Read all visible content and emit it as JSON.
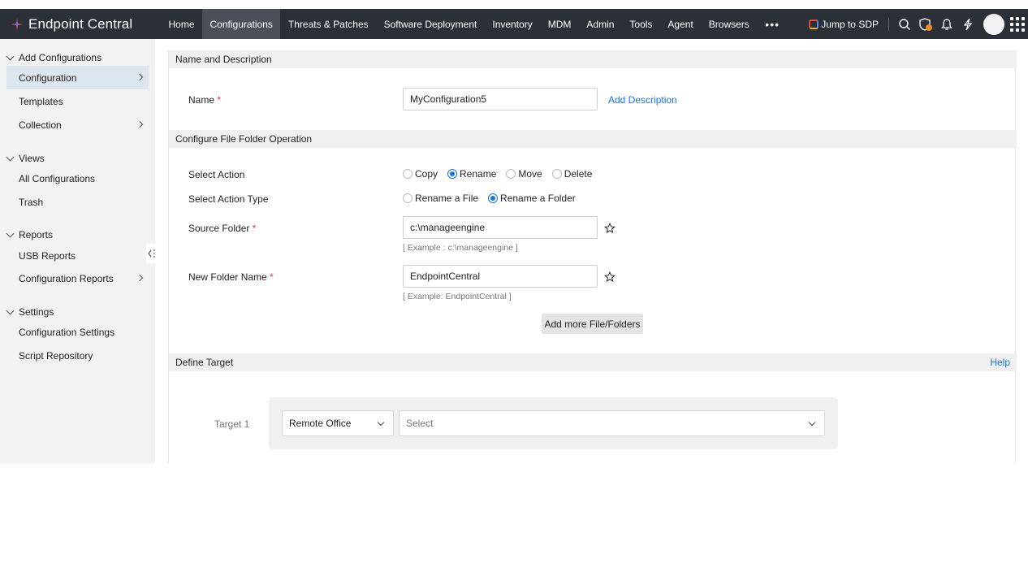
{
  "app": {
    "brand": "Endpoint Central",
    "nav": [
      "Home",
      "Configurations",
      "Threats & Patches",
      "Software Deployment",
      "Inventory",
      "MDM",
      "Admin",
      "Tools",
      "Agent",
      "Browsers"
    ],
    "active_nav": "Configurations",
    "more_label": "•••",
    "jump_label": "Jump to SDP",
    "icons": [
      "search-icon",
      "shield-alert-icon",
      "bell-icon",
      "lightning-icon",
      "avatar",
      "apps-grid-icon"
    ]
  },
  "sidebar": {
    "groups": [
      {
        "label": "Add Configurations",
        "items": [
          {
            "label": "Configuration",
            "active": true,
            "arrow": true
          },
          {
            "label": "Templates",
            "arrow": false
          },
          {
            "label": "Collection",
            "arrow": true
          }
        ]
      },
      {
        "label": "Views",
        "items": [
          {
            "label": "All Configurations"
          },
          {
            "label": "Trash"
          }
        ]
      },
      {
        "label": "Reports",
        "items": [
          {
            "label": "USB Reports"
          },
          {
            "label": "Configuration Reports",
            "arrow": true
          }
        ]
      },
      {
        "label": "Settings",
        "items": [
          {
            "label": "Configuration Settings"
          },
          {
            "label": "Script Repository"
          }
        ]
      }
    ]
  },
  "form": {
    "section_name": "Name and Description",
    "name_label": "Name",
    "required_mark": "*",
    "name_value": "MyConfiguration5",
    "add_description": "Add Description",
    "section_file": "Configure File Folder Operation",
    "action_label": "Select Action",
    "actions": [
      {
        "label": "Copy",
        "selected": false
      },
      {
        "label": "Rename",
        "selected": true
      },
      {
        "label": "Move",
        "selected": false
      },
      {
        "label": "Delete",
        "selected": false
      }
    ],
    "action_type_label": "Select Action Type",
    "action_types": [
      {
        "label": "Rename a File",
        "selected": false
      },
      {
        "label": "Rename a Folder",
        "selected": true
      }
    ],
    "source_label": "Source Folder",
    "source_value": "c:\\manageengine",
    "source_hint": "[ Example : c:\\manageengine ]",
    "newname_label": "New Folder Name",
    "newname_value": "EndpointCentral",
    "newname_hint": "[ Example: EndpointCentral ]",
    "add_more": "Add more File/Folders",
    "section_target": "Define Target",
    "help": "Help",
    "target_label": "Target 1",
    "target_type": "Remote Office",
    "target_placeholder": "Select"
  },
  "colors": {
    "topbar": "#2b2f36",
    "accent": "#1a73e8",
    "required": "#e0372c"
  }
}
